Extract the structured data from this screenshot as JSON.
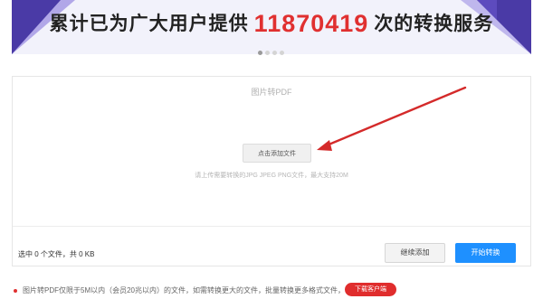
{
  "banner": {
    "text_before": "累计已为广大用户提供",
    "count": "11870419",
    "text_after": "次的转换服务",
    "carousel_dots": 4,
    "active_dot": 1
  },
  "panel": {
    "title": "图片转PDF",
    "add_button_label": "点击添加文件",
    "hint": "请上传需要转换的JPG JPEG PNG文件，最大支持20M"
  },
  "footer": {
    "status": "选中 0 个文件，共 0 KB",
    "continue_label": "继续添加",
    "start_label": "开始转换"
  },
  "notice": {
    "text": "图片转PDF仅限于5M以内（会员20兆以内）的文件，如需转换更大的文件，批量转换更多格式文件，请",
    "download_label": "下载客户端"
  },
  "colors": {
    "accent_red": "#e03030",
    "primary_blue": "#1e90ff",
    "banner_purple": "#4a3aa6"
  }
}
